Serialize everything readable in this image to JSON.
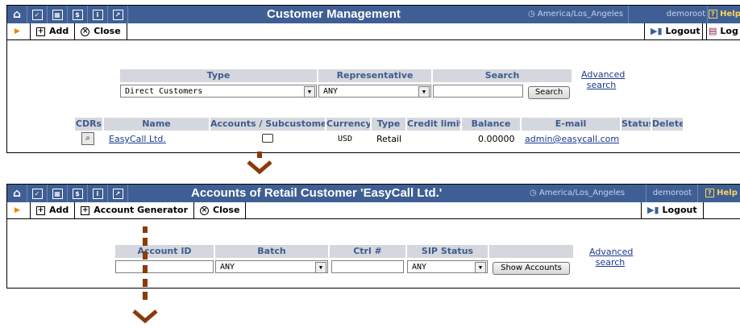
{
  "colors": {
    "titlebar": "#3f5f94",
    "header_text": "#3e5c8c",
    "header_bg": "#d4d7dd",
    "link": "#1b3a8a",
    "flow_arrow": "#8b3a0a"
  },
  "panel1": {
    "title": "Customer Management",
    "timezone": "America/Los_Angeles",
    "user": "demoroot",
    "help": "Help",
    "toolbar": {
      "add": "Add",
      "close": "Close",
      "logout": "Logout",
      "log": "Log"
    },
    "search": {
      "headers": {
        "type": "Type",
        "representative": "Representative",
        "search": "Search"
      },
      "type_value": "Direct Customers",
      "rep_value": "ANY",
      "search_value": "",
      "search_button": "Search",
      "advanced_1": "Advanced",
      "advanced_2": "search"
    },
    "table": {
      "columns": [
        "CDRs",
        "Name",
        "Accounts / Subcustomers",
        "Currency",
        "Type",
        "Credit limit",
        "Balance",
        "E-mail",
        "Status",
        "Delete"
      ],
      "row": {
        "name": "EasyCall Ltd.",
        "currency": "USD",
        "type": "Retail",
        "credit_limit": "",
        "balance": "0.00000",
        "email": "admin@easycall.com",
        "status": ""
      }
    }
  },
  "panel2": {
    "title": "Accounts of Retail Customer 'EasyCall Ltd.'",
    "timezone": "America/Los_Angeles",
    "user": "demoroot",
    "help": "Help",
    "toolbar": {
      "add": "Add",
      "generator": "Account Generator",
      "close": "Close",
      "logout": "Logout"
    },
    "search": {
      "headers": {
        "account_id": "Account ID",
        "batch": "Batch",
        "ctrl": "Ctrl #",
        "sip_status": "SIP Status"
      },
      "account_id_value": "",
      "batch_value": "ANY",
      "ctrl_value": "",
      "sip_value": "ANY",
      "button": "Show Accounts",
      "advanced_1": "Advanced",
      "advanced_2": "search"
    }
  },
  "icons": [
    "home-icon",
    "checkbox-icon",
    "grid-icon",
    "dollar-icon",
    "info-icon",
    "chart-icon",
    "magnifier-icon",
    "folder-icon",
    "logout-icon",
    "log-icon"
  ]
}
